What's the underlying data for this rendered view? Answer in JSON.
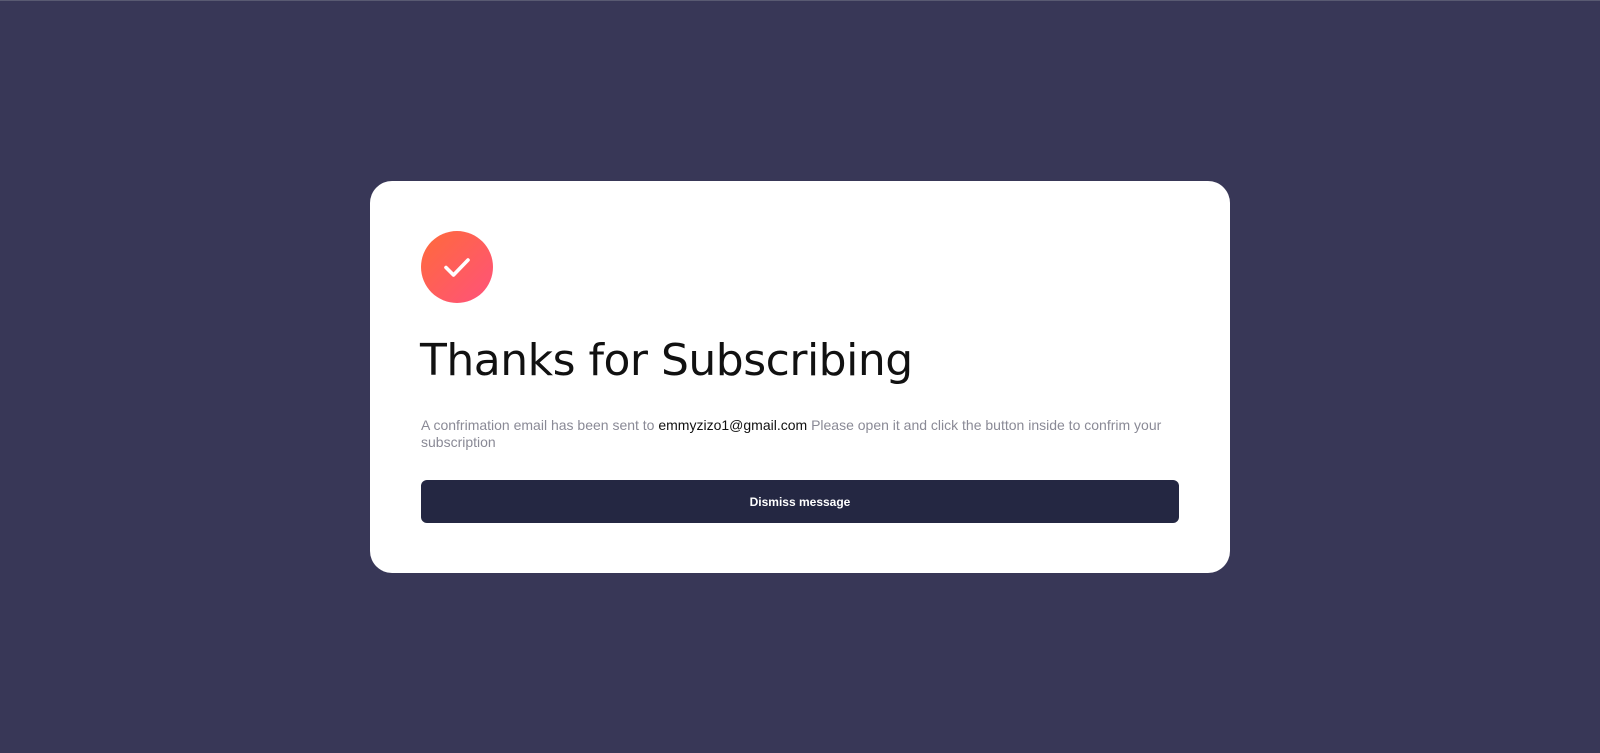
{
  "colors": {
    "page_background": "#383757",
    "card_background": "#ffffff",
    "button_background": "#242742",
    "badge_gradient": [
      "#ff6a3a",
      "#ff527b"
    ],
    "muted_text": "#8a8a96",
    "strong_text": "#111111"
  },
  "success_card": {
    "icon": "checkmark-icon",
    "title": "Thanks for Subscribing",
    "message_before": "A confrimation email has been sent to",
    "email": "emmyzizo1@gmail.com",
    "message_after": "Please open it and click the button inside to confrim your subscription",
    "dismiss_label": "Dismiss message"
  }
}
